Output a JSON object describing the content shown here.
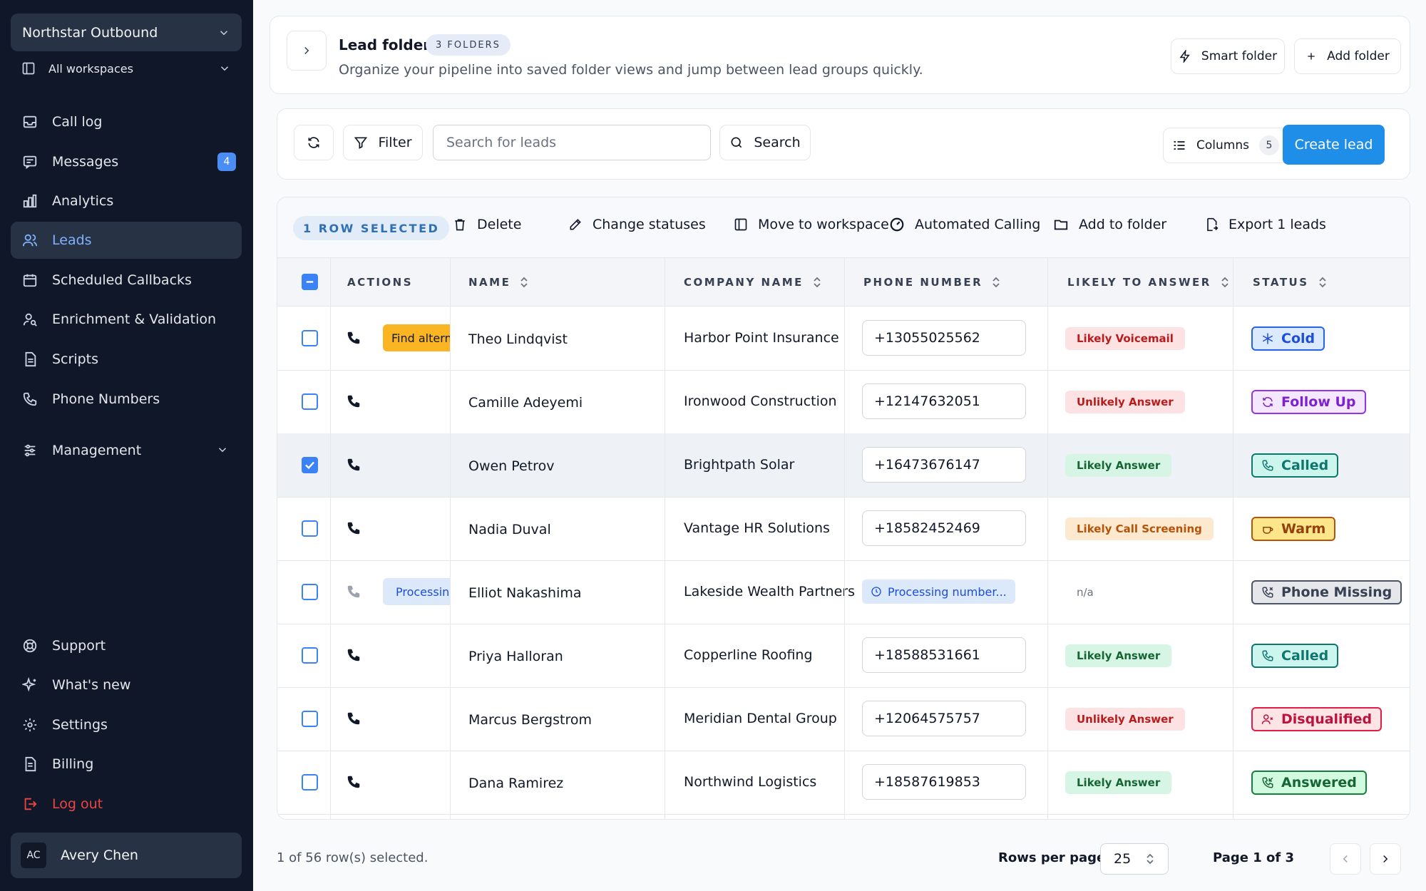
{
  "sidebar": {
    "workspace": "Northstar Outbound",
    "all_workspaces": "All workspaces",
    "nav": [
      {
        "label": "Call log",
        "icon": "inbox-icon"
      },
      {
        "label": "Messages",
        "icon": "message-icon",
        "badge": "4"
      },
      {
        "label": "Analytics",
        "icon": "bar-chart-icon"
      },
      {
        "label": "Leads",
        "icon": "users-icon",
        "active": true
      },
      {
        "label": "Scheduled Callbacks",
        "icon": "calendar-icon"
      },
      {
        "label": "Enrichment & Validation",
        "icon": "user-search-icon"
      },
      {
        "label": "Scripts",
        "icon": "file-icon"
      },
      {
        "label": "Phone Numbers",
        "icon": "phone-icon"
      },
      {
        "label": "Management",
        "icon": "sliders-icon"
      }
    ],
    "bottom_nav": [
      {
        "label": "Support",
        "icon": "lifebuoy-icon"
      },
      {
        "label": "What's new",
        "icon": "sparkles-icon"
      },
      {
        "label": "Settings",
        "icon": "gear-icon"
      },
      {
        "label": "Billing",
        "icon": "receipt-icon"
      },
      {
        "label": "Log out",
        "icon": "logout-icon"
      }
    ],
    "user": {
      "initials": "AC",
      "name": "Avery Chen"
    }
  },
  "folders": {
    "title": "Lead folders",
    "count": "3 FOLDERS",
    "subtitle": "Organize your pipeline into saved folder views and jump between lead groups quickly.",
    "smart_folder": "Smart folder",
    "add_folder": "Add folder"
  },
  "toolbar": {
    "filter": "Filter",
    "search_placeholder": "Search for leads",
    "search": "Search",
    "columns": "Columns",
    "columns_count": "5",
    "create": "Create lead"
  },
  "bulk": {
    "selected": "1 ROW SELECTED",
    "delete": "Delete",
    "change_statuses": "Change statuses",
    "move": "Move to workspace",
    "automated": "Automated Calling",
    "add_folder": "Add to folder",
    "export": "Export 1 leads"
  },
  "columns": {
    "actions": "ACTIONS",
    "name": "NAME",
    "company": "COMPANY NAME",
    "phone": "PHONE NUMBER",
    "likely": "LIKELY TO ANSWER",
    "status": "STATUS"
  },
  "rows": [
    {
      "name": "Theo Lindqvist",
      "company": "Harbor Point Insurance",
      "phone": "+13055025562",
      "likely": "Likely Voicemail",
      "likely_kind": "voicemail",
      "status": "Cold",
      "status_kind": "cold",
      "chip": "Find alternative",
      "chip_kind": "amber"
    },
    {
      "name": "Camille Adeyemi",
      "company": "Ironwood Construction",
      "phone": "+12147632051",
      "likely": "Unlikely Answer",
      "likely_kind": "unlikely",
      "status": "Follow Up",
      "status_kind": "followup"
    },
    {
      "name": "Owen Petrov",
      "company": "Brightpath Solar",
      "phone": "+16473676147",
      "likely": "Likely Answer",
      "likely_kind": "answer",
      "status": "Called",
      "status_kind": "called",
      "selected": true
    },
    {
      "name": "Nadia Duval",
      "company": "Vantage HR Solutions",
      "phone": "+18582452469",
      "likely": "Likely Call Screening",
      "likely_kind": "screening",
      "status": "Warm",
      "status_kind": "warm"
    },
    {
      "name": "Elliot Nakashima",
      "company": "Lakeside Wealth Partners",
      "phone_processing": "Processing number...",
      "likely": "n/a",
      "likely_kind": "na",
      "status": "Phone Missing",
      "status_kind": "missing",
      "chip": "Processing",
      "chip_kind": "blue"
    },
    {
      "name": "Priya Halloran",
      "company": "Copperline Roofing",
      "phone": "+18588531661",
      "likely": "Likely Answer",
      "likely_kind": "answer",
      "status": "Called",
      "status_kind": "called"
    },
    {
      "name": "Marcus Bergstrom",
      "company": "Meridian Dental Group",
      "phone": "+12064575757",
      "likely": "Unlikely Answer",
      "likely_kind": "unlikely",
      "status": "Disqualified",
      "status_kind": "disq"
    },
    {
      "name": "Dana Ramirez",
      "company": "Northwind Logistics",
      "phone": "+18587619853",
      "likely": "Likely Answer",
      "likely_kind": "answer",
      "status": "Answered",
      "status_kind": "answered"
    }
  ],
  "footer": {
    "selected_text": "1 of 56 row(s) selected.",
    "rows_per_page_label": "Rows per page",
    "rows_per_page": "25",
    "page": "Page 1 of 3"
  },
  "colors": {
    "sidebar_bg": "#0f1729",
    "accent": "#1f8ee9",
    "active_nav": "#7fb2ff"
  }
}
